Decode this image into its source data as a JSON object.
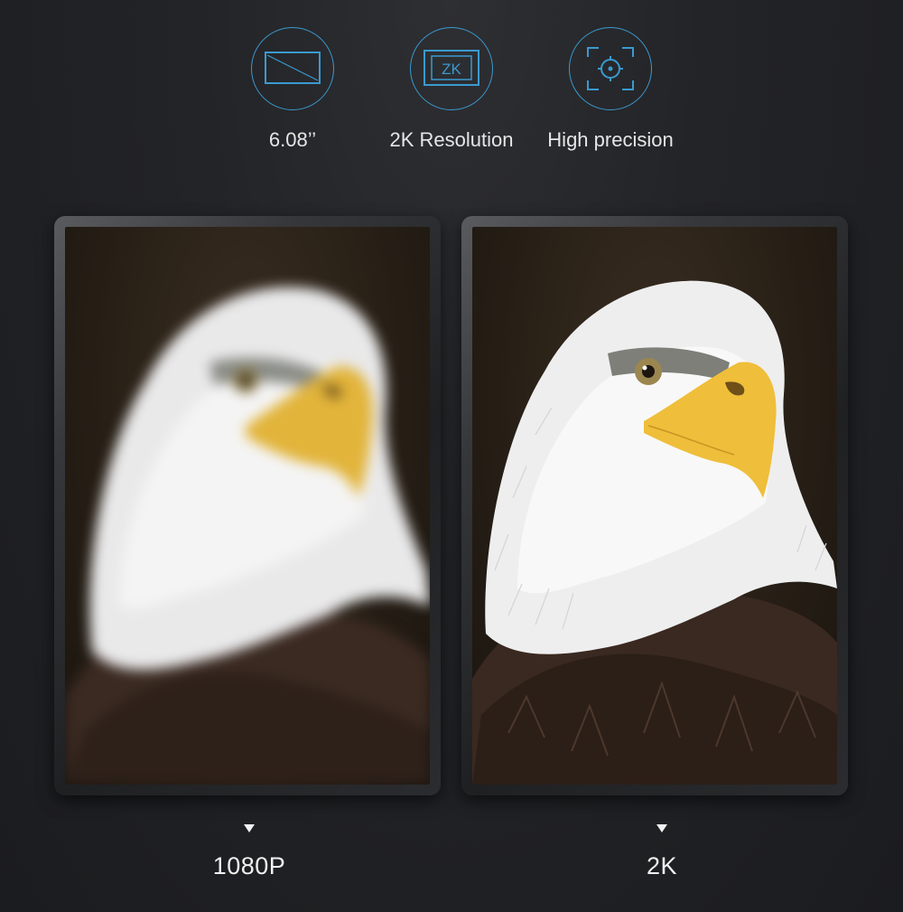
{
  "colors": {
    "accent": "#3a9ad0",
    "background": "#232427",
    "text": "#e6e6e6"
  },
  "features": [
    {
      "icon": "screen-size-icon",
      "label": "6.08’’"
    },
    {
      "icon": "2k-resolution-icon",
      "icon_text": "ZK",
      "label": "2K Resolution"
    },
    {
      "icon": "precision-target-icon",
      "label": "High precision"
    }
  ],
  "comparison": [
    {
      "image": "bald-eagle-blurred",
      "label": "1080P"
    },
    {
      "image": "bald-eagle-sharp",
      "label": "2K"
    }
  ]
}
